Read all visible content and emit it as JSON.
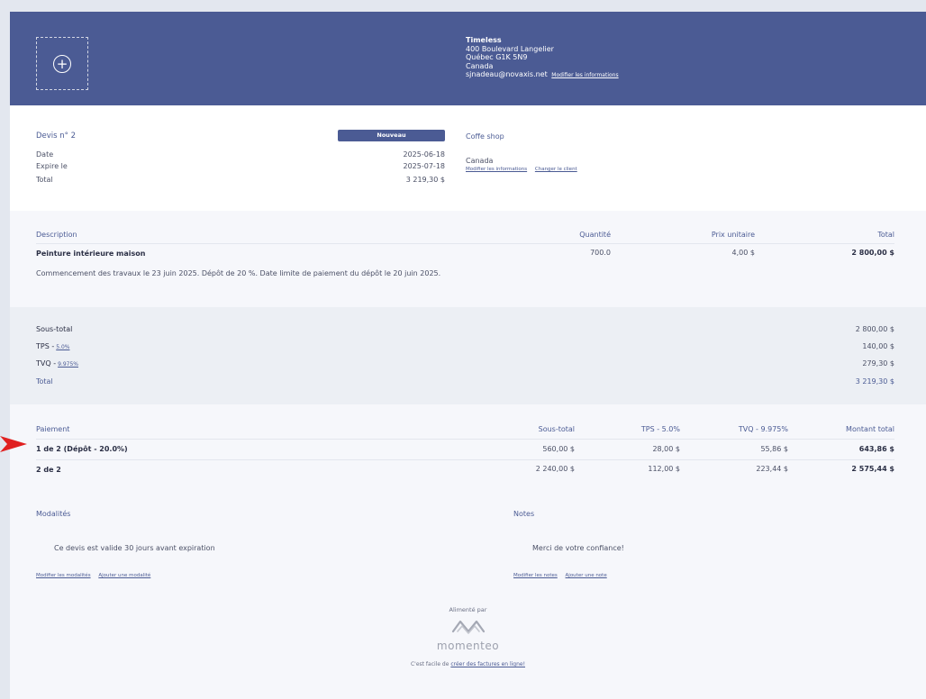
{
  "header": {
    "company_name": "Timeless",
    "address_line1": "400 Boulevard Langelier",
    "address_line2": "Québec G1K 5N9",
    "country": "Canada",
    "email": "sjnadeau@novaxis.net",
    "edit_link": "Modifier les informations"
  },
  "quote": {
    "title": "Devis n° 2",
    "status": "Nouveau",
    "date_label": "Date",
    "date_value": "2025-06-18",
    "expire_label": "Expire le",
    "expire_value": "2025-07-18",
    "total_label": "Total",
    "total_value": "3 219,30 $"
  },
  "client": {
    "name": "Coffe shop",
    "country": "Canada",
    "edit_link": "Modifier les informations",
    "change_link": "Changer le client"
  },
  "items": {
    "headers": [
      "Description",
      "Quantité",
      "Prix unitaire",
      "Total"
    ],
    "rows": [
      {
        "name": "Peinture intérieure maison",
        "quantity": "700.0",
        "unit_price": "4,00 $",
        "total": "2 800,00 $",
        "description": "Commencement des travaux le 23 juin 2025. Dépôt de 20 %. Date limite de paiement du dépôt le 20 juin 2025."
      }
    ]
  },
  "totals": {
    "subtotal_label": "Sous-total",
    "subtotal_value": "2 800,00 $",
    "tps_label": "TPS -",
    "tps_rate": "5.0%",
    "tps_value": "140,00 $",
    "tvq_label": "TVQ -",
    "tvq_rate": "9.975%",
    "tvq_value": "279,30 $",
    "total_label": "Total",
    "total_value": "3 219,30 $"
  },
  "payments": {
    "headers": [
      "Paiement",
      "Sous-total",
      "TPS - 5.0%",
      "TVQ - 9.975%",
      "Montant total"
    ],
    "rows": [
      {
        "label": "1 de 2 (Dépôt - 20.0%)",
        "subtotal": "560,00 $",
        "tps": "28,00 $",
        "tvq": "55,86 $",
        "total": "643,86 $"
      },
      {
        "label": "2 de 2",
        "subtotal": "2 240,00 $",
        "tps": "112,00 $",
        "tvq": "223,44 $",
        "total": "2 575,44 $"
      }
    ]
  },
  "terms": {
    "title": "Modalités",
    "text": "Ce devis est valide 30 jours avant expiration",
    "edit_link": "Modifier les modalités",
    "add_link": "Ajouter une modalité"
  },
  "notes": {
    "title": "Notes",
    "text": "Merci de votre confiance!",
    "edit_link": "Modifier les notes",
    "add_link": "Ajouter une note"
  },
  "footer": {
    "powered_by": "Alimenté par",
    "brand": "momenteo",
    "tagline_prefix": "C'est facile de",
    "tagline_link": "créer des factures en ligne!"
  },
  "colors": {
    "primary": "#4b5b94",
    "arrow": "#e02020"
  }
}
